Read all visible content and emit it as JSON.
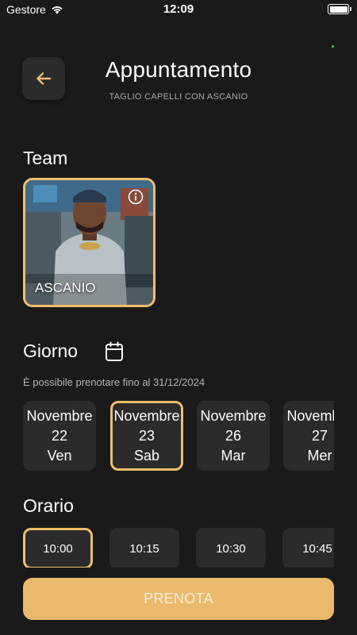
{
  "status_bar": {
    "carrier": "Gestore",
    "time": "12:09",
    "battery_level": 1.0
  },
  "header": {
    "title": "Appuntamento",
    "subtitle": "TAGLIO CAPELLI CON ASCANIO",
    "back_icon": "arrow-left-icon"
  },
  "team": {
    "heading": "Team",
    "members": [
      {
        "name": "ASCANIO",
        "selected": true
      }
    ]
  },
  "day": {
    "heading": "Giorno",
    "calendar_icon": "calendar-icon",
    "note": "È possibile prenotare fino al 31/12/2024",
    "options": [
      {
        "month": "Novembre",
        "date": "22",
        "weekday": "Ven",
        "selected": false
      },
      {
        "month": "Novembre",
        "date": "23",
        "weekday": "Sab",
        "selected": true
      },
      {
        "month": "Novembre",
        "date": "26",
        "weekday": "Mar",
        "selected": false
      },
      {
        "month": "Novembre",
        "date": "27",
        "weekday": "Mer",
        "selected": false
      }
    ]
  },
  "time": {
    "heading": "Orario",
    "options": [
      {
        "label": "10:00",
        "selected": true
      },
      {
        "label": "10:15",
        "selected": false
      },
      {
        "label": "10:30",
        "selected": false
      },
      {
        "label": "10:45",
        "selected": false
      }
    ]
  },
  "actions": {
    "book_label": "PRENOTA"
  },
  "colors": {
    "accent": "#f0bd6c",
    "background": "#1a1a1a",
    "surface": "#2b2b2b",
    "button": "#ebb96c"
  }
}
